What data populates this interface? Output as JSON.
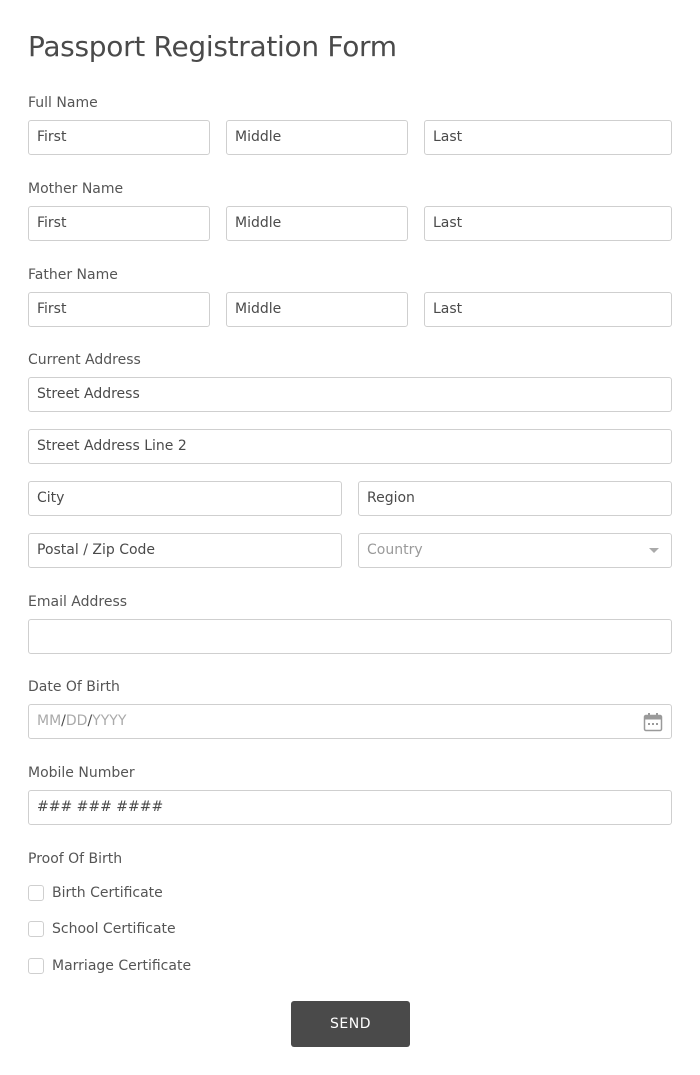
{
  "form": {
    "title": "Passport Registration Form",
    "full_name": {
      "label": "Full Name",
      "first": "First",
      "middle": "Middle",
      "last": "Last"
    },
    "mother_name": {
      "label": "Mother Name",
      "first": "First",
      "middle": "Middle",
      "last": "Last"
    },
    "father_name": {
      "label": "Father Name",
      "first": "First",
      "middle": "Middle",
      "last": "Last"
    },
    "address": {
      "label": "Current Address",
      "street": "Street Address",
      "street2": "Street Address Line 2",
      "city": "City",
      "region": "Region",
      "postal": "Postal / Zip Code",
      "country_placeholder": "Country"
    },
    "email": {
      "label": "Email Address",
      "value": ""
    },
    "dob": {
      "label": "Date Of Birth",
      "mm": "MM",
      "dd": "DD",
      "yyyy": "YYYY",
      "sep": "/"
    },
    "mobile": {
      "label": "Mobile Number",
      "placeholder": "### ### ####"
    },
    "proof": {
      "label": "Proof Of Birth",
      "options": [
        {
          "label": "Birth Certificate",
          "checked": false
        },
        {
          "label": "School Certificate",
          "checked": false
        },
        {
          "label": "Marriage Certificate",
          "checked": false
        }
      ]
    },
    "submit_label": "SEND"
  }
}
